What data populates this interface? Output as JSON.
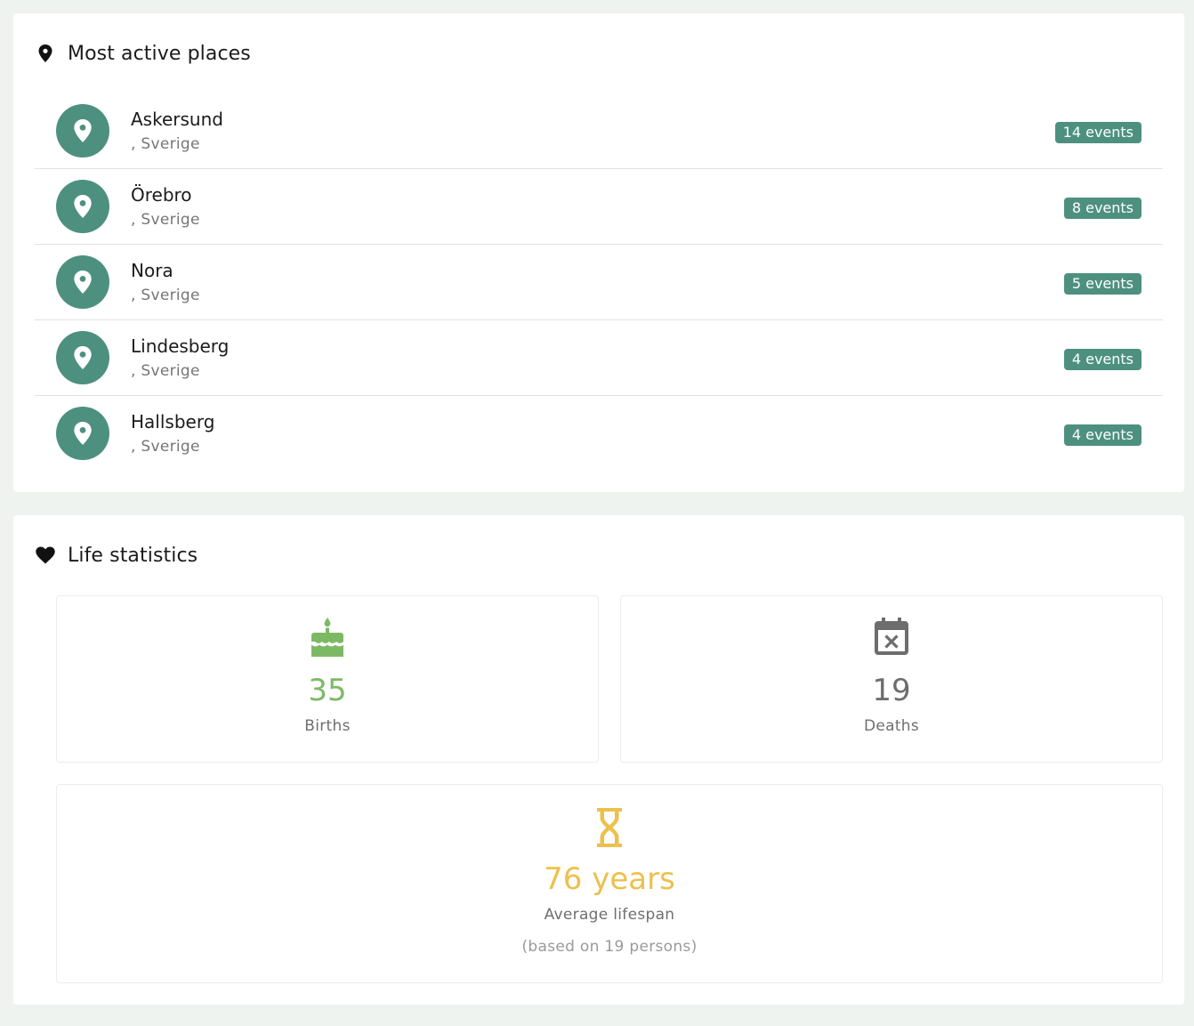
{
  "colors": {
    "page_background": "#eff3ef",
    "accent_teal": "#4d9080",
    "births_green": "#7db965",
    "deaths_gray": "#6d6d6d",
    "lifespan_yellow": "#edc04d"
  },
  "places": {
    "title": "Most active places",
    "icon": "location-pin-icon",
    "items": [
      {
        "name": "Askersund",
        "country": ", Sverige",
        "events": "14 events"
      },
      {
        "name": "Örebro",
        "country": ", Sverige",
        "events": "8 events"
      },
      {
        "name": "Nora",
        "country": ", Sverige",
        "events": "5 events"
      },
      {
        "name": "Lindesberg",
        "country": ", Sverige",
        "events": "4 events"
      },
      {
        "name": "Hallsberg",
        "country": ", Sverige",
        "events": "4 events"
      }
    ]
  },
  "life_statistics": {
    "title": "Life statistics",
    "icon": "heart-icon",
    "births": {
      "value": "35",
      "label": "Births",
      "icon": "birthday-cake-icon"
    },
    "deaths": {
      "value": "19",
      "label": "Deaths",
      "icon": "calendar-remove-icon"
    },
    "lifespan": {
      "value": "76 years",
      "label": "Average lifespan",
      "note": "(based on 19 persons)",
      "icon": "hourglass-icon"
    }
  }
}
